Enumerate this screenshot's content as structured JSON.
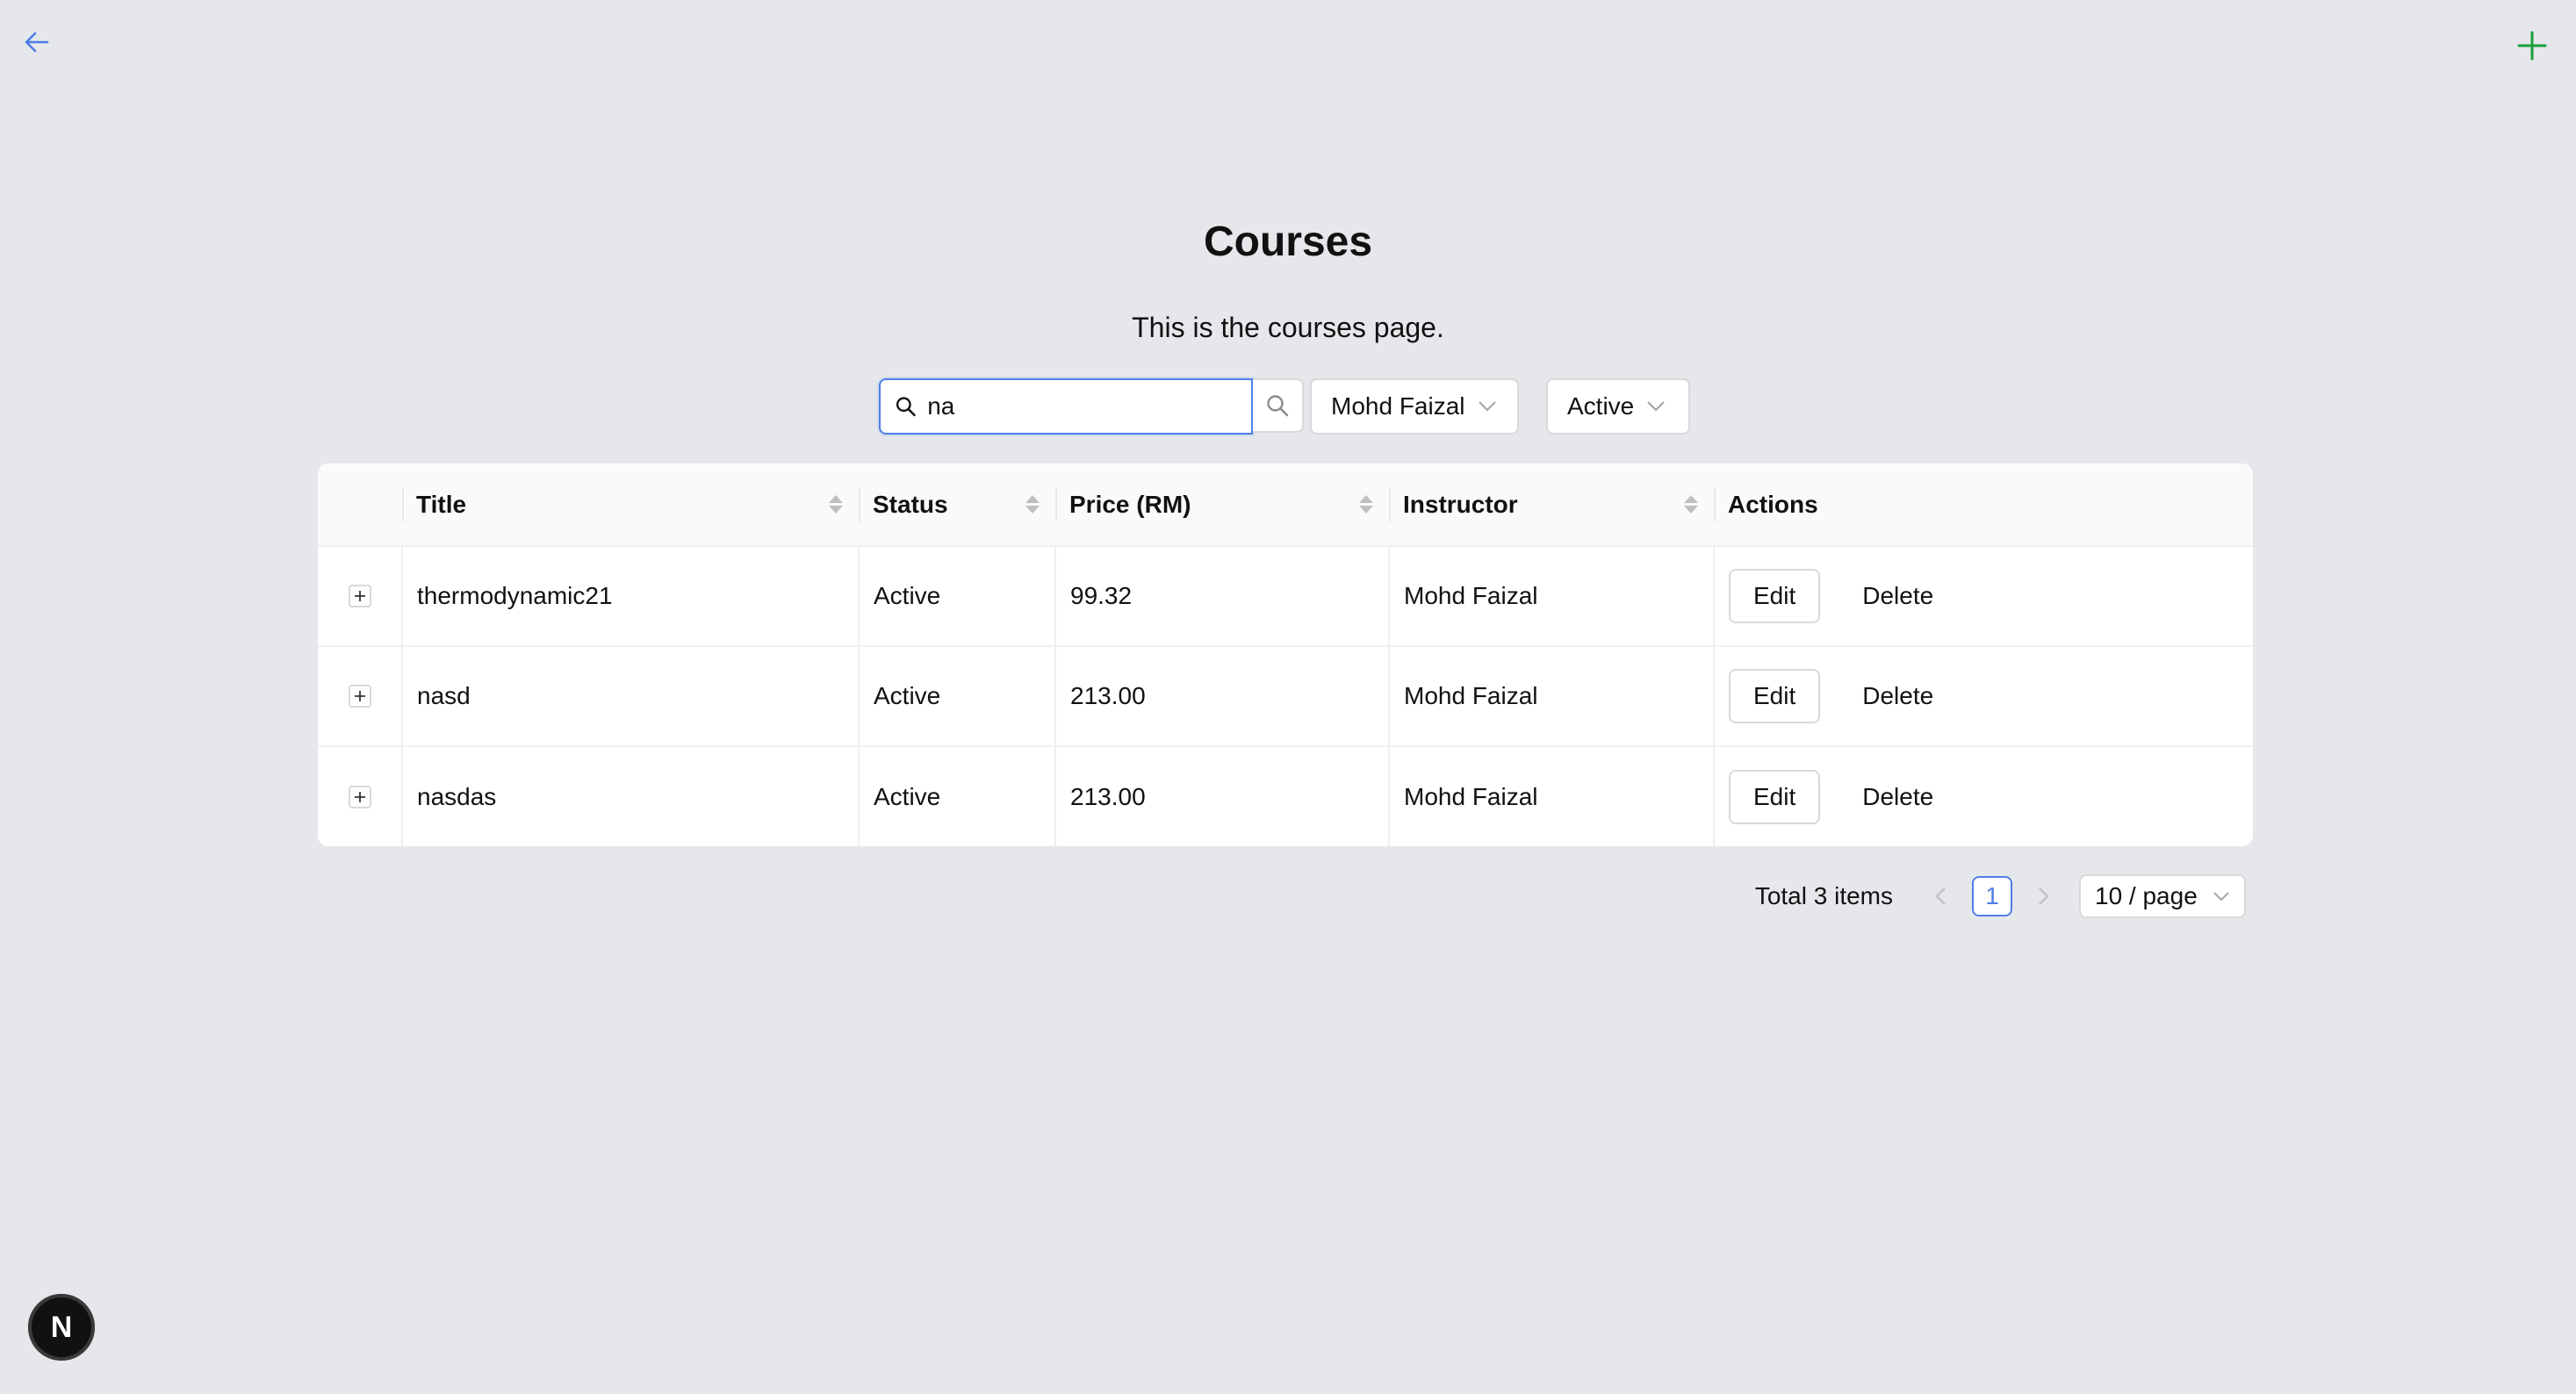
{
  "header": {
    "title": "Courses",
    "subtitle": "This is the courses page."
  },
  "search": {
    "value": "na",
    "placeholder": ""
  },
  "filters": {
    "instructor": "Mohd Faizal",
    "status": "Active"
  },
  "table": {
    "columns": [
      "Title",
      "Status",
      "Price (RM)",
      "Instructor",
      "Actions"
    ],
    "rows": [
      {
        "title": "thermodynamic21",
        "status": "Active",
        "price": "99.32",
        "instructor": "Mohd Faizal"
      },
      {
        "title": "nasd",
        "status": "Active",
        "price": "213.00",
        "instructor": "Mohd Faizal"
      },
      {
        "title": "nasdas",
        "status": "Active",
        "price": "213.00",
        "instructor": "Mohd Faizal"
      }
    ],
    "actions": {
      "edit": "Edit",
      "delete": "Delete"
    }
  },
  "pagination": {
    "total": "Total 3 items",
    "current_page": "1",
    "page_size": "10 / page"
  },
  "avatar": {
    "letter": "N"
  },
  "colors": {
    "accent": "#4f7ee8",
    "add": "#1a9e3a",
    "background": "#e5e7eb"
  },
  "icons": {
    "back": "arrow-left-icon",
    "add": "plus-icon",
    "search": "search-icon",
    "dropdown": "chevron-down-icon",
    "expand": "plus-square-icon"
  }
}
